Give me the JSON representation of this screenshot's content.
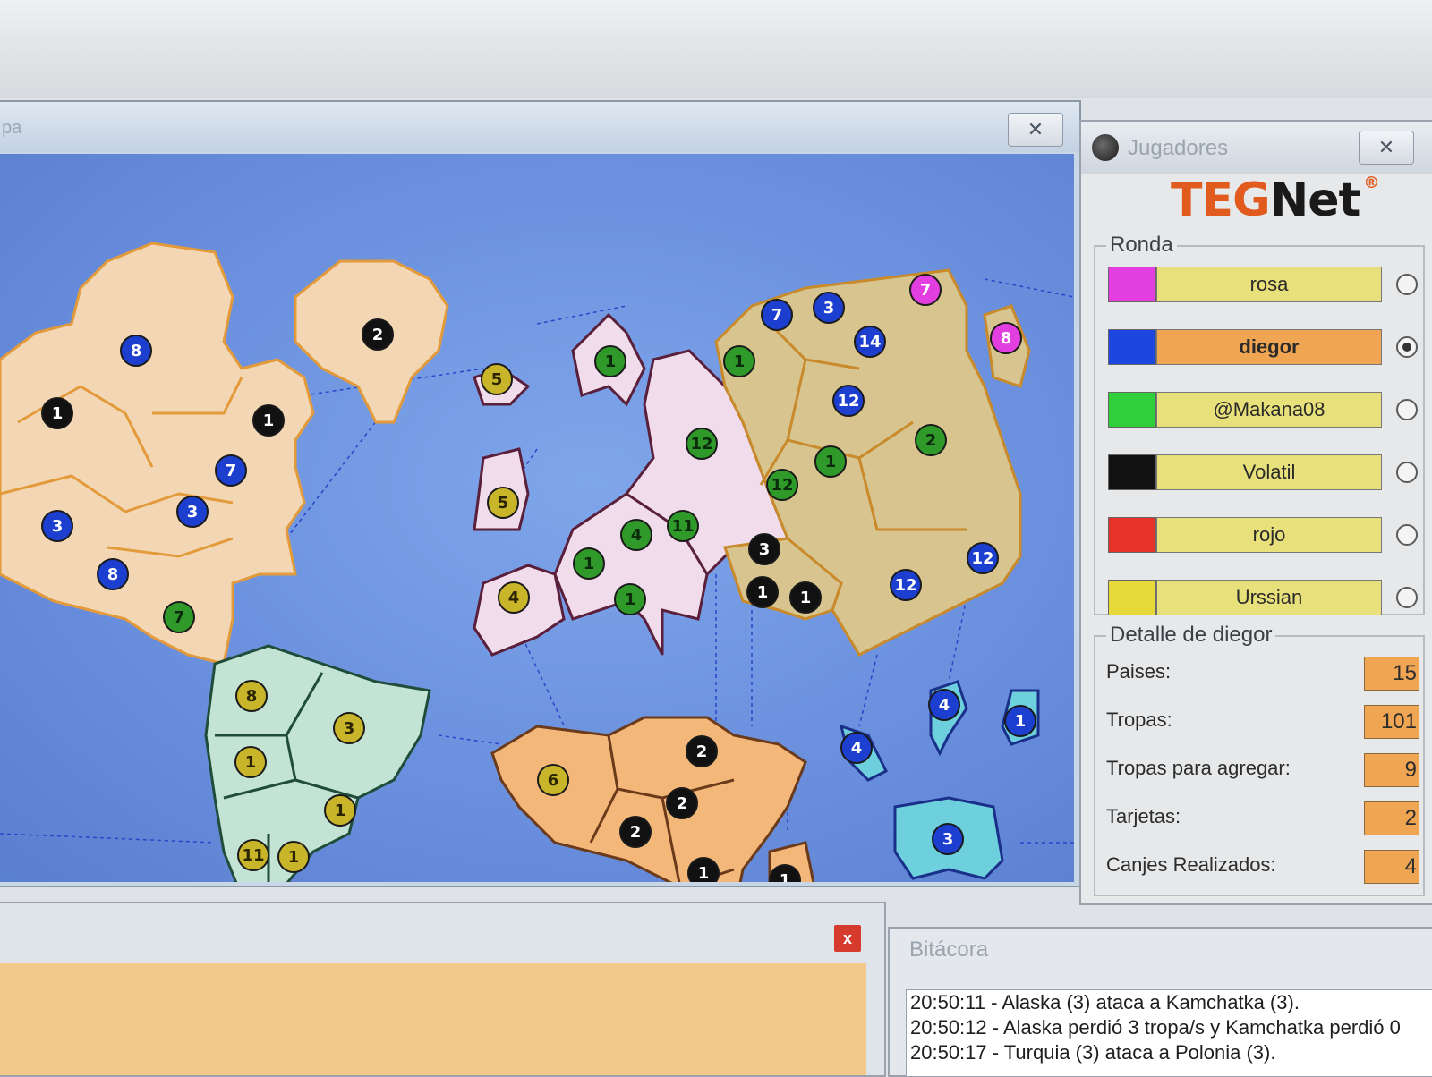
{
  "map_window": {
    "title_fragment": "pa",
    "close_glyph": "✕",
    "armies": [
      {
        "n": "1",
        "color": "black"
      },
      {
        "n": "8",
        "color": "blue"
      },
      {
        "n": "2",
        "color": "black"
      },
      {
        "n": "1",
        "color": "black"
      },
      {
        "n": "7",
        "color": "blue"
      },
      {
        "n": "3",
        "color": "blue"
      },
      {
        "n": "3",
        "color": "blue"
      },
      {
        "n": "8",
        "color": "blue"
      },
      {
        "n": "7",
        "color": "green"
      },
      {
        "n": "5",
        "color": "yellow"
      },
      {
        "n": "5",
        "color": "yellow"
      },
      {
        "n": "4",
        "color": "yellow"
      },
      {
        "n": "1",
        "color": "green"
      },
      {
        "n": "12",
        "color": "green"
      },
      {
        "n": "4",
        "color": "green"
      },
      {
        "n": "11",
        "color": "green"
      },
      {
        "n": "1",
        "color": "green"
      },
      {
        "n": "1",
        "color": "green"
      },
      {
        "n": "7",
        "color": "blue"
      },
      {
        "n": "3",
        "color": "blue"
      },
      {
        "n": "7",
        "color": "pink"
      },
      {
        "n": "8",
        "color": "pink"
      },
      {
        "n": "1",
        "color": "green"
      },
      {
        "n": "14",
        "color": "blue"
      },
      {
        "n": "12",
        "color": "blue"
      },
      {
        "n": "2",
        "color": "green"
      },
      {
        "n": "1",
        "color": "green"
      },
      {
        "n": "12",
        "color": "green"
      },
      {
        "n": "3",
        "color": "black"
      },
      {
        "n": "1",
        "color": "black"
      },
      {
        "n": "1",
        "color": "black"
      },
      {
        "n": "12",
        "color": "blue"
      },
      {
        "n": "12",
        "color": "blue"
      },
      {
        "n": "8",
        "color": "yellow"
      },
      {
        "n": "3",
        "color": "yellow"
      },
      {
        "n": "1",
        "color": "yellow"
      },
      {
        "n": "1",
        "color": "yellow"
      },
      {
        "n": "11",
        "color": "yellow"
      },
      {
        "n": "1",
        "color": "yellow"
      },
      {
        "n": "6",
        "color": "yellow"
      },
      {
        "n": "2",
        "color": "black"
      },
      {
        "n": "2",
        "color": "black"
      },
      {
        "n": "2",
        "color": "black"
      },
      {
        "n": "1",
        "color": "black"
      },
      {
        "n": "1",
        "color": "black"
      },
      {
        "n": "4",
        "color": "blue"
      },
      {
        "n": "4",
        "color": "blue"
      },
      {
        "n": "1",
        "color": "blue"
      },
      {
        "n": "3",
        "color": "blue"
      }
    ]
  },
  "players_window": {
    "title": "Jugadores",
    "close_glyph": "✕",
    "logo": {
      "part1": "TEG",
      "part2": "Net",
      "mark": "®"
    },
    "round_label": "Ronda",
    "players": [
      {
        "name": "rosa",
        "color": "#e23ee0",
        "active": false
      },
      {
        "name": "diegor",
        "color": "#1d46e0",
        "active": true
      },
      {
        "name": "@Makana08",
        "color": "#2fcf3a",
        "active": false
      },
      {
        "name": "Volatil",
        "color": "#111111",
        "active": false
      },
      {
        "name": "rojo",
        "color": "#e5332a",
        "active": false
      },
      {
        "name": "Urssian",
        "color": "#e8d93a",
        "active": false
      }
    ],
    "detail_label": "Detalle de diegor",
    "details": [
      {
        "label": "Paises:",
        "value": "15"
      },
      {
        "label": "Tropas:",
        "value": "101"
      },
      {
        "label": "Tropas para agregar:",
        "value": "9"
      },
      {
        "label": "Tarjetas:",
        "value": "2"
      },
      {
        "label": "Canjes Realizados:",
        "value": "4"
      }
    ]
  },
  "bottom_window": {
    "close_glyph": "x"
  },
  "log_window": {
    "title": "Bitácora",
    "lines": [
      "20:50:11 - Alaska (3) ataca a Kamchatka (3).",
      "20:50:12 - Alaska perdió 3 tropa/s y Kamchatka perdió 0",
      "20:50:17 - Turquia (3) ataca a Polonia (3)."
    ]
  },
  "colors": {
    "blue": "#1d3fd0",
    "black": "#111111",
    "green": "#2f9a2a",
    "yellow": "#c9b52a",
    "pink": "#e33fe0",
    "accent_orange": "#f0a552"
  }
}
